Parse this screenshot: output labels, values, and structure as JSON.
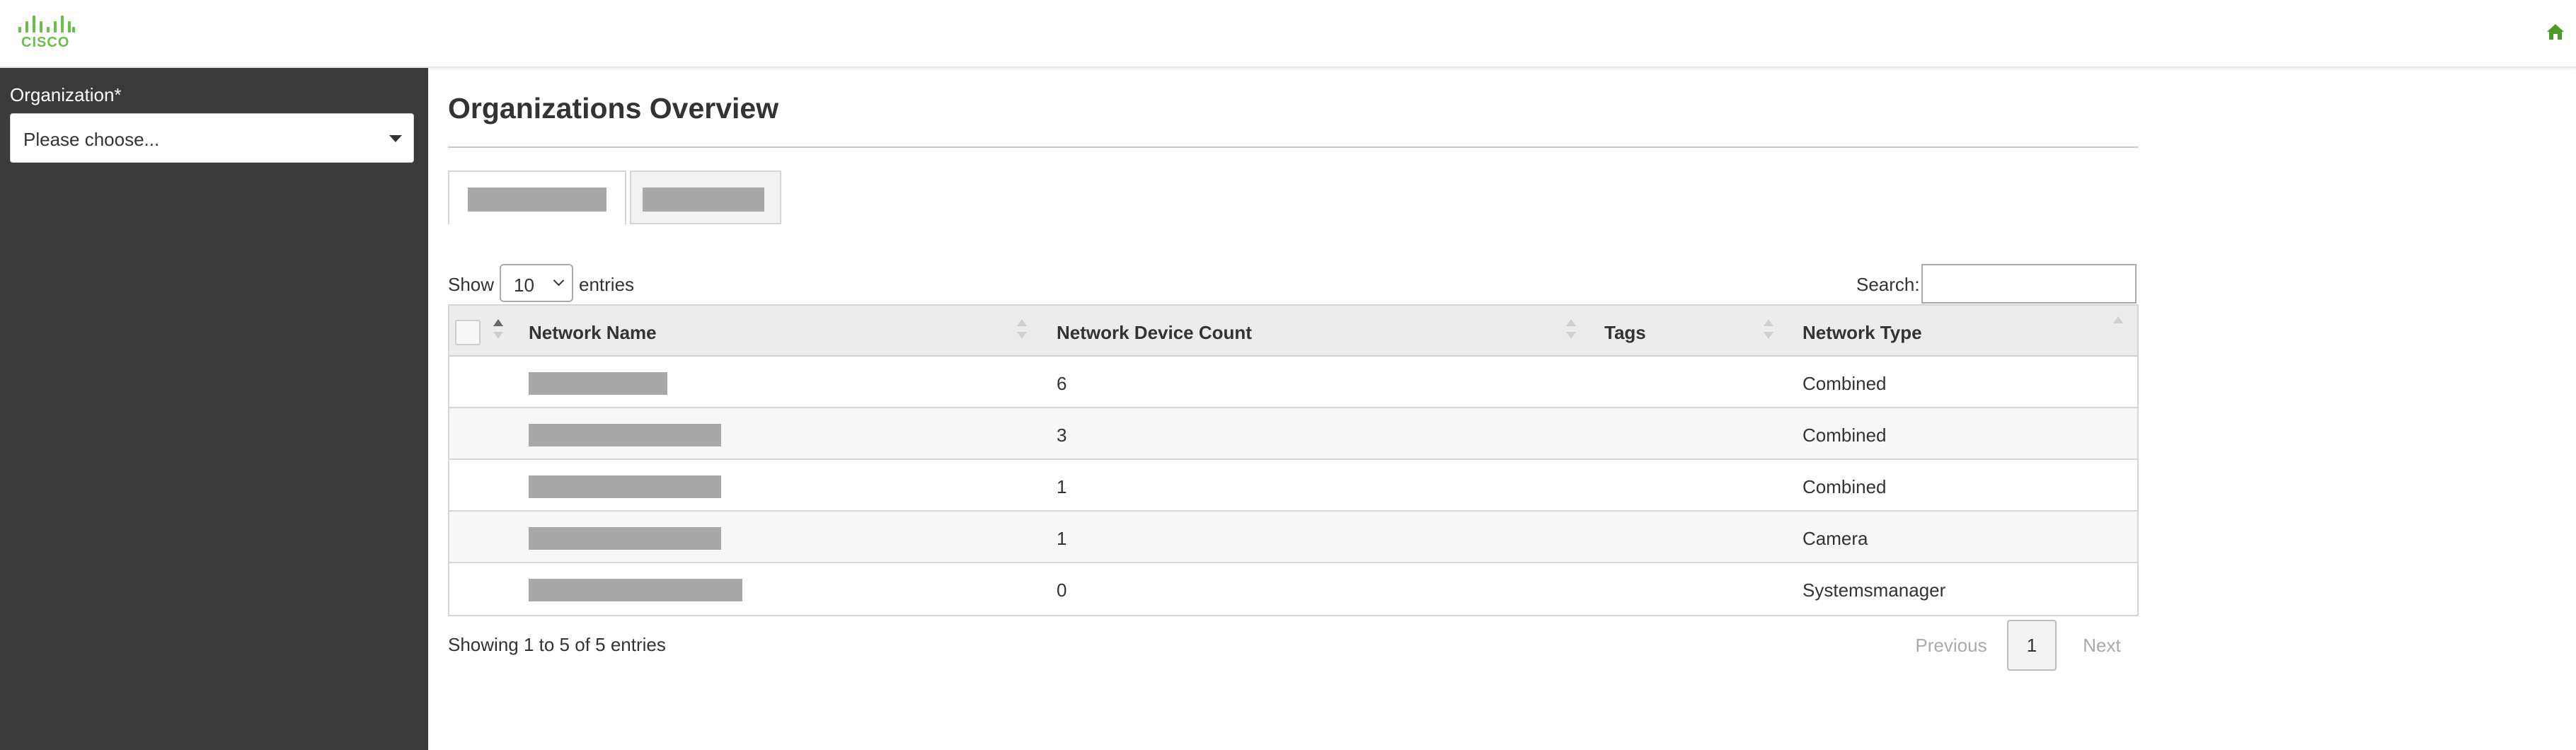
{
  "brand": {
    "logo_text": "CISCO",
    "color": "#6abf4b"
  },
  "header": {
    "home_icon": "home-icon"
  },
  "sidebar": {
    "organization_label": "Organization*",
    "organization_select": {
      "value": "Please choose..."
    }
  },
  "page": {
    "title": "Organizations Overview"
  },
  "tabs": [
    {
      "label": "",
      "redacted": true,
      "active": true
    },
    {
      "label": "",
      "redacted": true,
      "active": false
    }
  ],
  "table_controls": {
    "show_label": "Show",
    "entries_value": "10",
    "entries_label": "entries",
    "search_label": "Search:",
    "search_value": ""
  },
  "table": {
    "columns": [
      "Network Name",
      "Network Device Count",
      "Tags",
      "Network Type"
    ],
    "rows": [
      {
        "network_name": "",
        "device_count": "6",
        "tags": "",
        "network_type": "Combined"
      },
      {
        "network_name": "",
        "device_count": "3",
        "tags": "",
        "network_type": "Combined"
      },
      {
        "network_name": "",
        "device_count": "1",
        "tags": "",
        "network_type": "Combined"
      },
      {
        "network_name": "",
        "device_count": "1",
        "tags": "",
        "network_type": "Camera"
      },
      {
        "network_name": "",
        "device_count": "0",
        "tags": "",
        "network_type": "Systemsmanager"
      }
    ]
  },
  "footer": {
    "info": "Showing 1 to 5 of 5 entries",
    "previous": "Previous",
    "current_page": "1",
    "next": "Next"
  },
  "colors": {
    "sidebar_bg": "#3a3a3a",
    "redaction": "#a8a8a8",
    "header_row_bg": "#ececec",
    "striped_row_bg": "#f7f7f7"
  }
}
